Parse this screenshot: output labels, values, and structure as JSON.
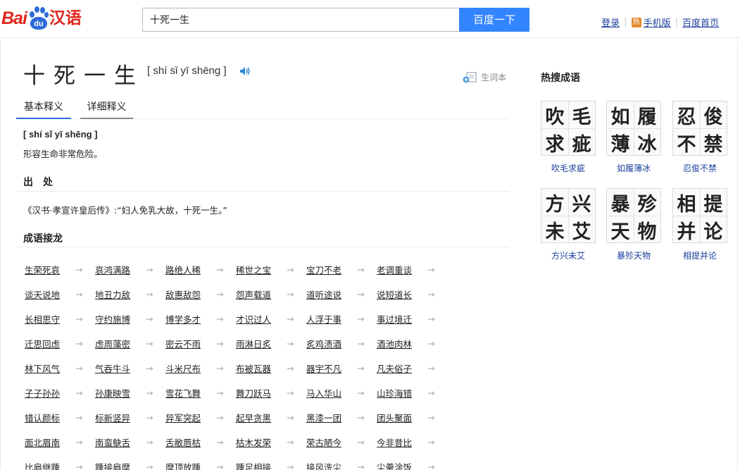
{
  "logo": {
    "bai": "Bai",
    "du": "du",
    "hanyu": "汉语"
  },
  "search": {
    "value": "十死一生",
    "button_label": "百度一下"
  },
  "toplinks": {
    "login": "登录",
    "hot_badge": "热",
    "mobile": "手机版",
    "home": "百度首页"
  },
  "word": {
    "title": "十死一生",
    "pinyin": "[ shí sǐ yī shēng ]",
    "vocab_label": "生词本",
    "tabs": [
      "基本释义",
      "详细释义"
    ],
    "def_pinyin": "[ shí sǐ yī shēng ]",
    "definition": "形容生命非常危险。"
  },
  "source": {
    "title": "出　处",
    "text": "《汉书·孝宣许皇后传》:“妇人免乳大故，十死一生。”"
  },
  "chain": {
    "title": "成语接龙",
    "arrow": "→",
    "rows": [
      [
        "生荣死哀",
        "哀鸿满路",
        "路绝人稀",
        "稀世之宝",
        "宝刀不老",
        "老调重谈"
      ],
      [
        "谈天说地",
        "地丑力敌",
        "敌惠敌怨",
        "怨声载道",
        "道听途说",
        "说短道长"
      ],
      [
        "长相思守",
        "守约施博",
        "博学多才",
        "才识过人",
        "人浮于事",
        "事过境迁"
      ],
      [
        "迁思回虑",
        "虑周藻密",
        "密云不雨",
        "雨淋日炙",
        "炙鸡渍酒",
        "酒池肉林"
      ],
      [
        "林下风气",
        "气吞牛斗",
        "斗米尺布",
        "布被瓦器",
        "器宇不凡",
        "凡夫俗子"
      ],
      [
        "子子孙孙",
        "孙康映雪",
        "雪花飞舞",
        "舞刀跃马",
        "马入华山",
        "山珍海错"
      ],
      [
        "错认颜标",
        "标新竖异",
        "异军突起",
        "起早贪黑",
        "黑漆一团",
        "团头聚面"
      ],
      [
        "面北眉南",
        "南蛮鴃舌",
        "舌敝唇枯",
        "枯木发荣",
        "荣古陋今",
        "今非昔比"
      ],
      [
        "比肩继踵",
        "踵接肩摩",
        "摩顶放踵",
        "踵足相接",
        "接风洗尘",
        "尘羹涂饭"
      ]
    ]
  },
  "sidebar": {
    "title": "热搜成语",
    "idioms": [
      {
        "chars": [
          "吹",
          "毛",
          "求",
          "疵"
        ],
        "label": "吹毛求疵"
      },
      {
        "chars": [
          "如",
          "履",
          "薄",
          "冰"
        ],
        "label": "如履薄冰"
      },
      {
        "chars": [
          "忍",
          "俊",
          "不",
          "禁"
        ],
        "label": "忍俊不禁"
      },
      {
        "chars": [
          "方",
          "兴",
          "未",
          "艾"
        ],
        "label": "方兴未艾"
      },
      {
        "chars": [
          "暴",
          "殄",
          "天",
          "物"
        ],
        "label": "暴殄天物"
      },
      {
        "chars": [
          "相",
          "提",
          "并",
          "论"
        ],
        "label": "相提并论"
      }
    ]
  },
  "colors": {
    "brand_red": "#e1251b",
    "brand_blue": "#2b6ad9",
    "search_button": "#3385ff",
    "link": "#1a3e9c"
  },
  "icons": {
    "sound": "speaker-icon",
    "vocab": "add-notebook-icon"
  }
}
